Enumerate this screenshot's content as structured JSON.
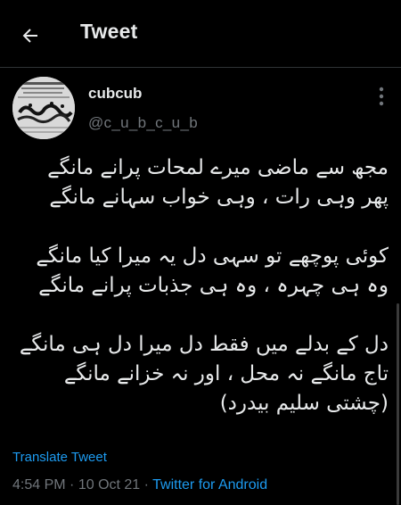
{
  "header": {
    "title": "Tweet",
    "back_icon": "arrow-left-icon"
  },
  "author": {
    "display_name": "cubcub",
    "handle": "@c_u_b_c_u_b",
    "avatar_icon": "newspaper-clipping-avatar",
    "more_icon": "more-vertical-icon"
  },
  "tweet": {
    "lines": [
      "مجھ سے ماضی  میرے لمحات پرانے مانگے",
      "پھر وہی  رات ، وہی خواب سہانے مانگے",
      "",
      "کوئی پوچھے تو سہی دل یہ میرا کیا مانگے",
      "وہ  ہی  چہرہ  ، وہ ہی جذبات پرانے مانگے",
      "",
      "دل کے بدلے میں فقط دل میرا دل ہی مانگے",
      "تاج مانگے  نہ  محل ، اور  نہ  خزانے مانگے",
      "(چشتی سلیم بیدرد)"
    ],
    "translate_label": "Translate Tweet",
    "time": "4:54 PM",
    "separator": "·",
    "date": "10 Oct 21",
    "source": "Twitter for Android"
  },
  "colors": {
    "background": "#000000",
    "text": "#e7e9ea",
    "secondary": "#71767b",
    "accent": "#1d9bf0",
    "divider": "#2f3336"
  }
}
